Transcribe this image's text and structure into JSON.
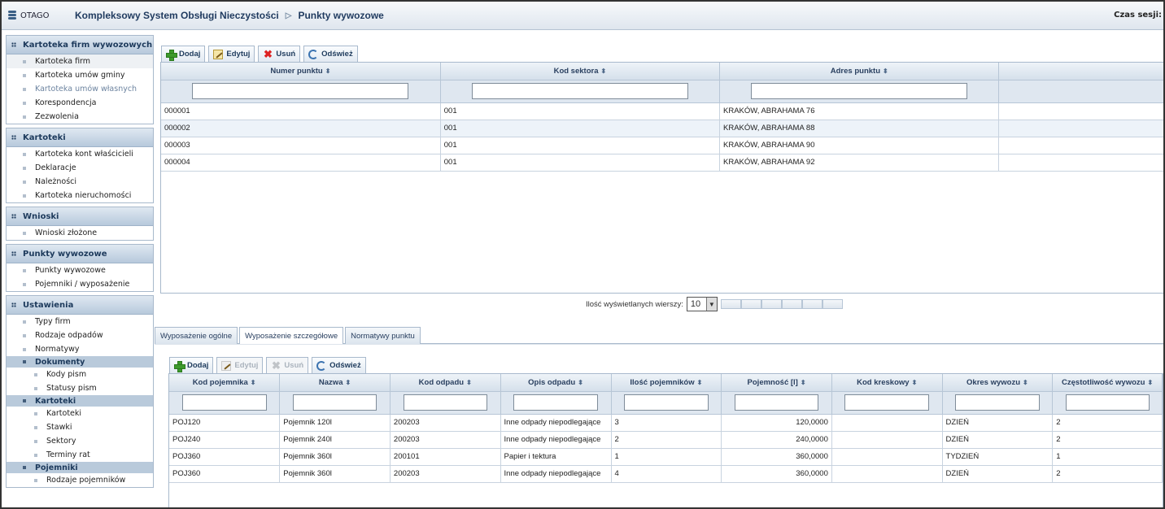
{
  "header": {
    "logo": "OTAGO",
    "app_title": "Kompleksowy System Obsługi Nieczystości",
    "separator": "▷",
    "page_title": "Punkty wywozowe",
    "session_label": "Czas sesji:"
  },
  "sidebar": {
    "sections": [
      {
        "title": "Kartoteka firm wywozowych",
        "items": [
          "Kartoteka firm",
          "Kartoteka umów gminy",
          "Kartoteka umów własnych",
          "Korespondencja",
          "Zezwolenia"
        ]
      },
      {
        "title": "Kartoteki",
        "items": [
          "Kartoteka kont właścicieli",
          "Deklaracje",
          "Należności",
          "Kartoteka nieruchomości"
        ]
      },
      {
        "title": "Wnioski",
        "items": [
          "Wnioski złożone"
        ]
      },
      {
        "title": "Punkty wywozowe",
        "items": [
          "Punkty wywozowe",
          "Pojemniki / wyposażenie"
        ]
      },
      {
        "title": "Ustawienia",
        "items": [
          "Typy firm",
          "Rodzaje odpadów",
          "Normatywy"
        ],
        "groups": [
          {
            "title": "Dokumenty",
            "items": [
              "Kody pism",
              "Statusy pism"
            ]
          },
          {
            "title": "Kartoteki",
            "items": [
              "Kartoteki",
              "Stawki",
              "Sektory",
              "Terminy rat"
            ]
          },
          {
            "title": "Pojemniki",
            "items": [
              "Rodzaje pojemników"
            ]
          }
        ]
      }
    ]
  },
  "top_toolbar": {
    "add": "Dodaj",
    "edit": "Edytuj",
    "delete": "Usuń",
    "refresh": "Odśwież"
  },
  "top_grid": {
    "columns": [
      "Numer punktu",
      "Kod sektora",
      "Adres punktu"
    ],
    "rows": [
      [
        "000001",
        "001",
        "KRAKÓW, ABRAHAMA 76"
      ],
      [
        "000002",
        "001",
        "KRAKÓW, ABRAHAMA 88"
      ],
      [
        "000003",
        "001",
        "KRAKÓW, ABRAHAMA 90"
      ],
      [
        "000004",
        "001",
        "KRAKÓW, ABRAHAMA 92"
      ]
    ]
  },
  "pager": {
    "label": "Ilość wyświetlanych wierszy:",
    "value": "10"
  },
  "tabs": [
    "Wyposażenie ogólne",
    "Wyposażenie szczegółowe",
    "Normatywy punktu"
  ],
  "bottom_toolbar": {
    "add": "Dodaj",
    "edit": "Edytuj",
    "delete": "Usuń",
    "refresh": "Odśwież"
  },
  "bottom_grid": {
    "columns": [
      "Kod pojemnika",
      "Nazwa",
      "Kod odpadu",
      "Opis odpadu",
      "Ilość pojemników",
      "Pojemność [l]",
      "Kod kreskowy",
      "Okres wywozu",
      "Częstotliwość wywozu"
    ],
    "rows": [
      [
        "POJ120",
        "Pojemnik 120l",
        "200203",
        "Inne odpady niepodlegające",
        "3",
        "120,0000",
        "",
        "DZIEŃ",
        "2"
      ],
      [
        "POJ240",
        "Pojemnik 240l",
        "200203",
        "Inne odpady niepodlegające",
        "2",
        "240,0000",
        "",
        "DZIEŃ",
        "2"
      ],
      [
        "POJ360",
        "Pojemnik 360l",
        "200101",
        "Papier i tektura",
        "1",
        "360,0000",
        "",
        "TYDZIEŃ",
        "1"
      ],
      [
        "POJ360",
        "Pojemnik 360l",
        "200203",
        "Inne odpady niepodlegające",
        "4",
        "360,0000",
        "",
        "DZIEŃ",
        "2"
      ]
    ]
  },
  "sort_glyph": "⬍"
}
